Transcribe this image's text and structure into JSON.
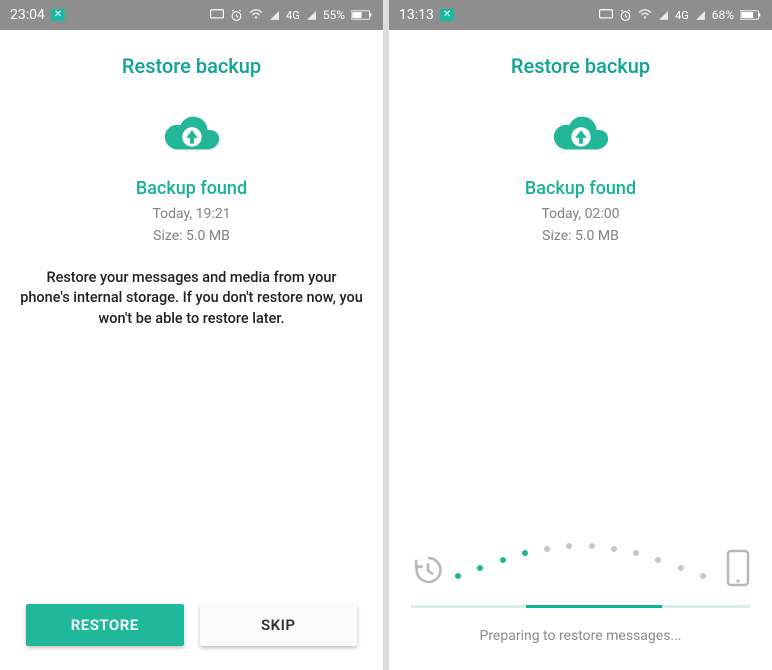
{
  "colors": {
    "accent": "#18b297",
    "primary_btn": "#20b89a",
    "grey_text": "#808080"
  },
  "left": {
    "status": {
      "time": "23:04",
      "signal_label": "4G",
      "battery_text": "55%"
    },
    "title": "Restore backup",
    "backup_found": "Backup found",
    "backup_time": "Today, 19:21",
    "backup_size": "Size: 5.0 MB",
    "description": "Restore your messages and media from your phone's internal storage. If you don't restore now, you won't be able to restore later.",
    "restore_btn": "RESTORE",
    "skip_btn": "SKIP"
  },
  "right": {
    "status": {
      "time": "13:13",
      "signal_label": "4G",
      "battery_text": "68%"
    },
    "title": "Restore backup",
    "backup_found": "Backup found",
    "backup_time": "Today, 02:00",
    "backup_size": "Size: 5.0 MB",
    "preparing_text": "Preparing to restore messages..."
  }
}
